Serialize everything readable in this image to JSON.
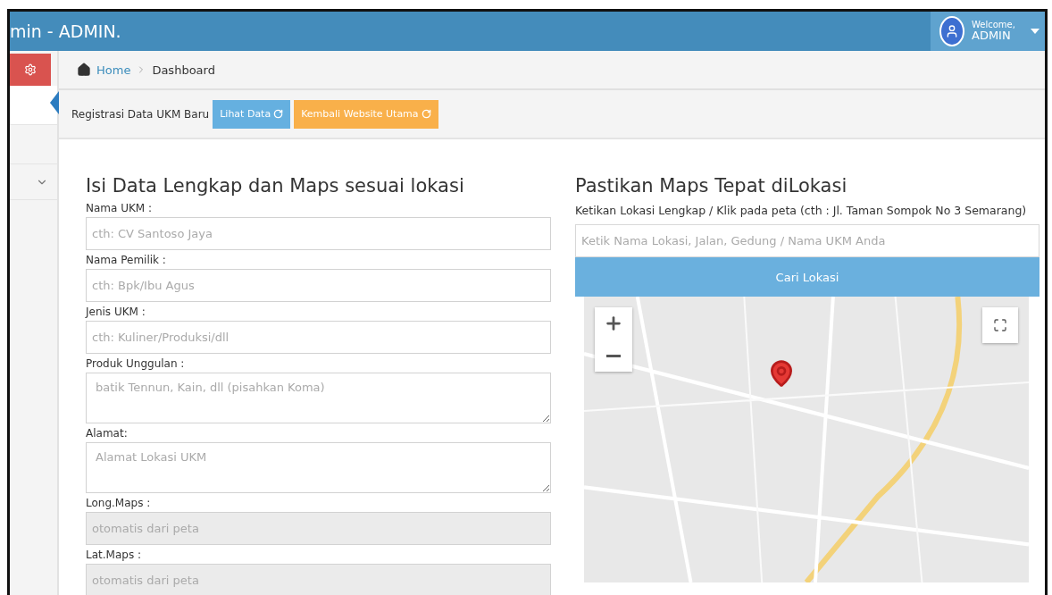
{
  "header": {
    "title": "min - ADMIN.",
    "user": {
      "greeting": "Welcome,",
      "name": "ADMIN"
    }
  },
  "breadcrumb": [
    "Home",
    "Dashboard"
  ],
  "toolbar": {
    "label": "Registrasi Data UKM Baru",
    "buttons": [
      {
        "label": "Lihat Data",
        "kind": "info"
      },
      {
        "label": "Kembali Website Utama",
        "kind": "warning"
      }
    ]
  },
  "form": {
    "title": "Isi Data Lengkap dan Maps sesuai lokasi",
    "fields": [
      {
        "label": "Nama UKM :",
        "placeholder": "cth: CV Santoso Jaya",
        "kind": "input",
        "disabled": false
      },
      {
        "label": "Nama Pemilik :",
        "placeholder": "cth: Bpk/Ibu Agus",
        "kind": "input",
        "disabled": false
      },
      {
        "label": "Jenis UKM :",
        "placeholder": "cth: Kuliner/Produksi/dll",
        "kind": "input",
        "disabled": false
      },
      {
        "label": "Produk Unggulan :",
        "placeholder": "batik Tennun, Kain, dll (pisahkan Koma)",
        "kind": "textarea",
        "disabled": false
      },
      {
        "label": "Alamat:",
        "placeholder": "Alamat Lokasi UKM",
        "kind": "textarea",
        "disabled": false
      },
      {
        "label": "Long.Maps :",
        "placeholder": "otomatis dari peta",
        "kind": "input",
        "disabled": true
      },
      {
        "label": "Lat.Maps :",
        "placeholder": "otomatis dari peta",
        "kind": "input",
        "disabled": true
      }
    ]
  },
  "map_panel": {
    "title": "Pastikan Maps Tepat diLokasi",
    "hint": "Ketikan Lokasi Lengkap / Klik pada peta (cth : Jl. Taman Sompok No 3 Semarang)",
    "search": {
      "placeholder": "Ketik Nama Lokasi, Jalan, Gedung / Nama UKM Anda"
    },
    "button": "Cari Lokasi"
  }
}
